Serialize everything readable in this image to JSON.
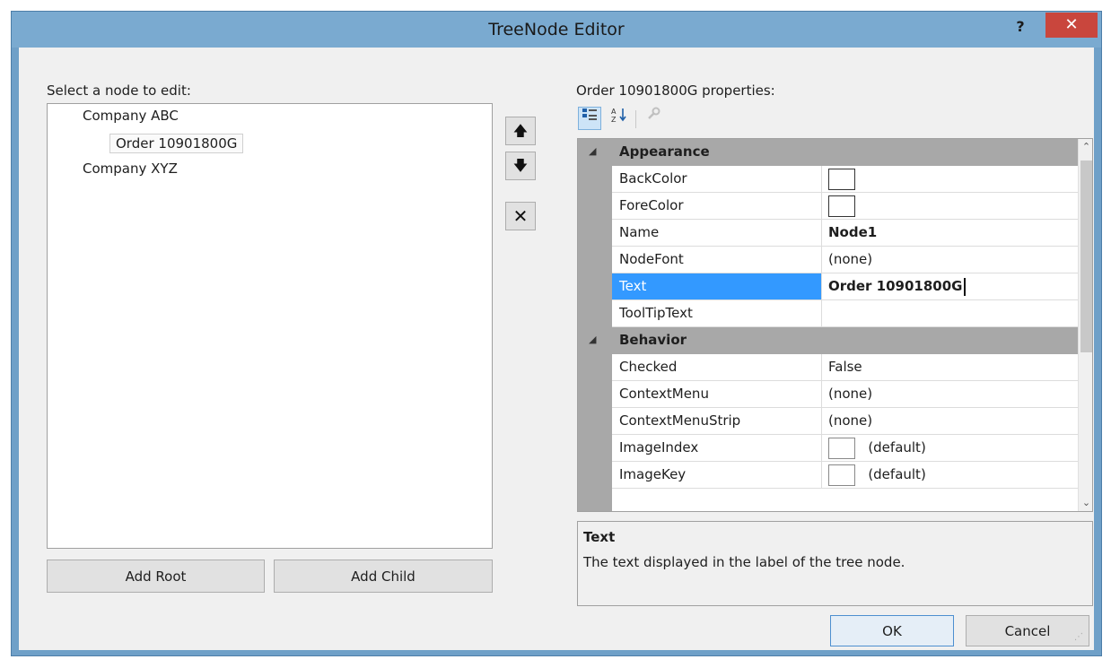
{
  "window": {
    "title": "TreeNode Editor",
    "help_label": "?",
    "close_label": "✕"
  },
  "tree_panel": {
    "label": "Select a node to edit:",
    "nodes": [
      {
        "label": "Company ABC"
      },
      {
        "label": "Order 10901800G"
      },
      {
        "label": "Company XYZ"
      }
    ],
    "add_root_label": "Add Root",
    "add_child_label": "Add Child"
  },
  "move_buttons": {
    "up": "🡅",
    "down": "🡇",
    "delete": "✕"
  },
  "properties": {
    "label": "Order 10901800G properties:",
    "toolbar": {
      "categorized_icon": "categorized-icon",
      "alphabetical_icon": "alphabetical-icon",
      "events_icon": "wrench-icon"
    },
    "categories": [
      {
        "name": "Appearance",
        "toggle": "◢",
        "rows": [
          {
            "name": "BackColor",
            "value": ""
          },
          {
            "name": "ForeColor",
            "value": ""
          },
          {
            "name": "Name",
            "value": "Node1"
          },
          {
            "name": "NodeFont",
            "value": "(none)"
          },
          {
            "name": "Text",
            "value": "Order 10901800G"
          },
          {
            "name": "ToolTipText",
            "value": ""
          }
        ]
      },
      {
        "name": "Behavior",
        "toggle": "◢",
        "rows": [
          {
            "name": "Checked",
            "value": "False"
          },
          {
            "name": "ContextMenu",
            "value": "(none)"
          },
          {
            "name": "ContextMenuStrip",
            "value": "(none)"
          },
          {
            "name": "ImageIndex",
            "value": "(default)"
          },
          {
            "name": "ImageKey",
            "value": "(default)"
          }
        ]
      }
    ],
    "description": {
      "title": "Text",
      "text": "The text displayed in the label of the tree node."
    }
  },
  "footer": {
    "ok_label": "OK",
    "cancel_label": "Cancel"
  },
  "colors": {
    "selection": "#3399ff",
    "title_bar": "#7aaad0",
    "close_button": "#c9463d"
  }
}
